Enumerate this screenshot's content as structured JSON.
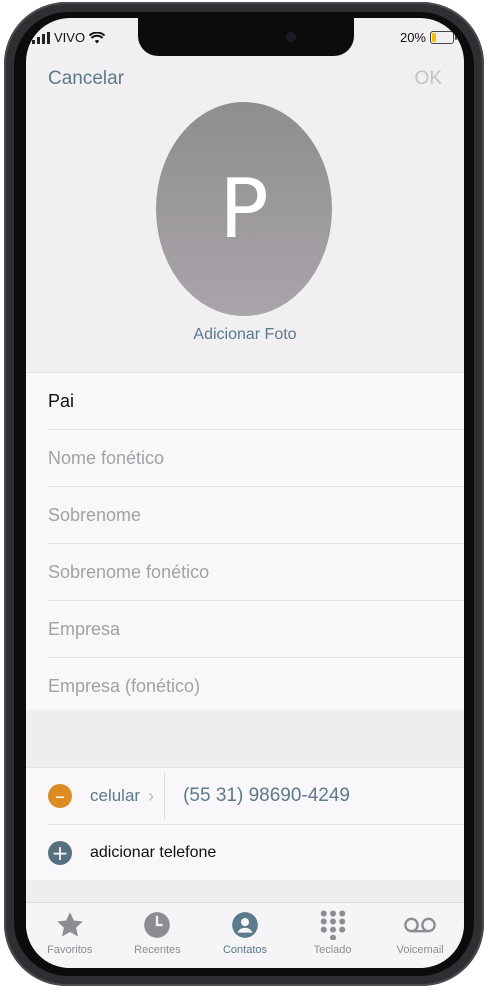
{
  "status": {
    "carrier": "VIVO",
    "battery": "20%",
    "battery_color": "#f2c200"
  },
  "nav": {
    "cancel": "Cancelar",
    "ok": "OK"
  },
  "avatar": {
    "initial": "P",
    "add_photo": "Adicionar Foto"
  },
  "form": {
    "first_name": "Pai",
    "phonetic_first_placeholder": "Nome fonético",
    "last_name_placeholder": "Sobrenome",
    "phonetic_last_placeholder": "Sobrenome fonético",
    "company_placeholder": "Empresa",
    "phonetic_company_placeholder": "Empresa (fonético)"
  },
  "phone": {
    "type_label": "celular",
    "number": "(55 31) 98690-4249",
    "add_label": "adicionar telefone"
  },
  "tabs": [
    {
      "label": "Favoritos",
      "icon": "star-icon"
    },
    {
      "label": "Recentes",
      "icon": "clock-icon"
    },
    {
      "label": "Contatos",
      "icon": "person-icon",
      "active": true
    },
    {
      "label": "Teclado",
      "icon": "keypad-icon"
    },
    {
      "label": "Voicemail",
      "icon": "voicemail-icon"
    }
  ],
  "colors": {
    "accent": "#5b7a8a",
    "minus": "#dc8c21",
    "plus": "#55707f"
  }
}
